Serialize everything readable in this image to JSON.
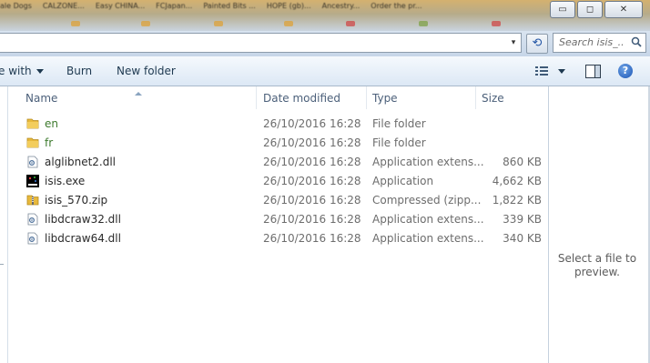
{
  "titlebar": {
    "tabs": [
      "ale Dogs",
      "CALZONE...",
      "Easy CHINA...",
      "FCJapan...",
      "Painted Bits ...",
      "HOPE (gb)...",
      "Ancestry...",
      "Order the pr..."
    ],
    "minimize_label": "▭",
    "maximize_label": "◻",
    "close_label": "✕"
  },
  "address": {
    "dropdown_glyph": "▾",
    "refresh_glyph": "⟲",
    "search_placeholder": "Search isis_..."
  },
  "toolbar": {
    "open_with_label": "e with",
    "burn_label": "Burn",
    "new_folder_label": "New folder",
    "help_glyph": "?"
  },
  "columns": {
    "name": "Name",
    "date": "Date modified",
    "type": "Type",
    "size": "Size"
  },
  "files": [
    {
      "name": "en",
      "date": "26/10/2016 16:28",
      "type": "File folder",
      "size": "",
      "icon": "folder-icon",
      "kind": "folder"
    },
    {
      "name": "fr",
      "date": "26/10/2016 16:28",
      "type": "File folder",
      "size": "",
      "icon": "folder-icon",
      "kind": "folder"
    },
    {
      "name": "alglibnet2.dll",
      "date": "26/10/2016 16:28",
      "type": "Application extens...",
      "size": "860 KB",
      "icon": "dll-icon",
      "kind": "dll"
    },
    {
      "name": "isis.exe",
      "date": "26/10/2016 16:28",
      "type": "Application",
      "size": "4,662 KB",
      "icon": "exe-icon",
      "kind": "exe"
    },
    {
      "name": "isis_570.zip",
      "date": "26/10/2016 16:28",
      "type": "Compressed (zipp...",
      "size": "1,822 KB",
      "icon": "zip-icon",
      "kind": "zip"
    },
    {
      "name": "libdcraw32.dll",
      "date": "26/10/2016 16:28",
      "type": "Application extens...",
      "size": "339 KB",
      "icon": "dll-icon",
      "kind": "dll"
    },
    {
      "name": "libdcraw64.dll",
      "date": "26/10/2016 16:28",
      "type": "Application extens...",
      "size": "340 KB",
      "icon": "dll-icon",
      "kind": "dll"
    }
  ],
  "preview": {
    "message": "Select a file to preview."
  },
  "colors": {
    "folder_name": "#3d7a2d",
    "toolbar_text": "#1e3950",
    "header_text": "#4c607a"
  }
}
